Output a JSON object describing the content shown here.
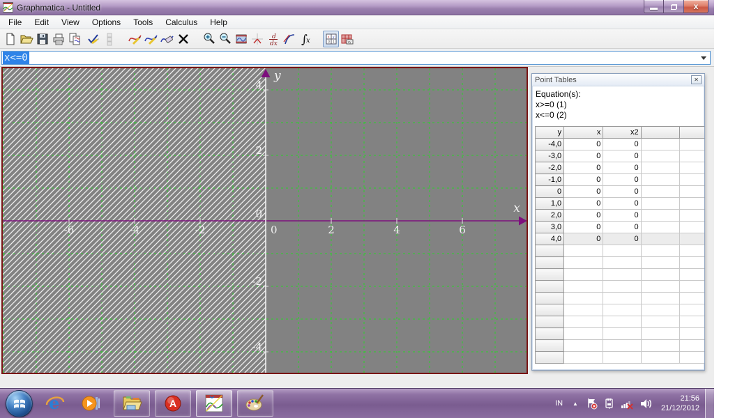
{
  "window": {
    "title": "Graphmatica - Untitled"
  },
  "menu": {
    "items": [
      "File",
      "Edit",
      "View",
      "Options",
      "Tools",
      "Calculus",
      "Help"
    ]
  },
  "toolbar": {
    "icons": [
      "new-file",
      "open-file",
      "save-file",
      "print",
      "copy",
      "edit-check",
      "dot-plot",
      "draw-graph",
      "redraw-graph",
      "erase-graph",
      "clear-screen",
      "zoom-in",
      "zoom-out",
      "grid-range",
      "default-range",
      "derivative",
      "tangent",
      "integrate",
      "point-tables",
      "annotations"
    ]
  },
  "equation_input": {
    "value": "x<=0"
  },
  "chart_data": {
    "type": "region-plot",
    "equations": [
      "x>=0",
      "x<=0"
    ],
    "shaded_region": "x<=0",
    "grid_step": 1,
    "x_axis": {
      "label": "x",
      "min": -8,
      "max": 8,
      "tick_labels": [
        "-6",
        "-4",
        "-2",
        "0",
        "2",
        "4",
        "6"
      ]
    },
    "y_axis": {
      "label": "y",
      "min": -4.6,
      "max": 4.6,
      "tick_labels": [
        "4",
        "2",
        "0",
        "-2",
        "-4"
      ]
    },
    "colors": {
      "background": "#828282",
      "grid": "#2bd22b",
      "axis": "#7d0f7d",
      "boundary": "#f0f0f0",
      "hatch": "#ffffff",
      "border": "#7a1515"
    }
  },
  "point_tables": {
    "title": "Point Tables",
    "equations_heading": "Equation(s):",
    "equations": [
      "x>=0 (1)",
      "x<=0 (2)"
    ],
    "columns": [
      "y",
      "x",
      "x2"
    ],
    "rows": [
      {
        "y": "-4,0",
        "x": "0",
        "x2": "0"
      },
      {
        "y": "-3,0",
        "x": "0",
        "x2": "0"
      },
      {
        "y": "-2,0",
        "x": "0",
        "x2": "0"
      },
      {
        "y": "-1,0",
        "x": "0",
        "x2": "0"
      },
      {
        "y": "0",
        "x": "0",
        "x2": "0"
      },
      {
        "y": "1,0",
        "x": "0",
        "x2": "0"
      },
      {
        "y": "2,0",
        "x": "0",
        "x2": "0"
      },
      {
        "y": "3,0",
        "x": "0",
        "x2": "0"
      },
      {
        "y": "4,0",
        "x": "0",
        "x2": "0"
      }
    ],
    "selected_row": "4,0",
    "empty_row_count": 10
  },
  "taskbar": {
    "apps": [
      "start",
      "internet-explorer",
      "media-player",
      "windows-explorer",
      "red-a-app",
      "graphmatica",
      "paint"
    ],
    "tray": {
      "language": "IN",
      "time": "21:56",
      "date": "21/12/2012"
    }
  }
}
